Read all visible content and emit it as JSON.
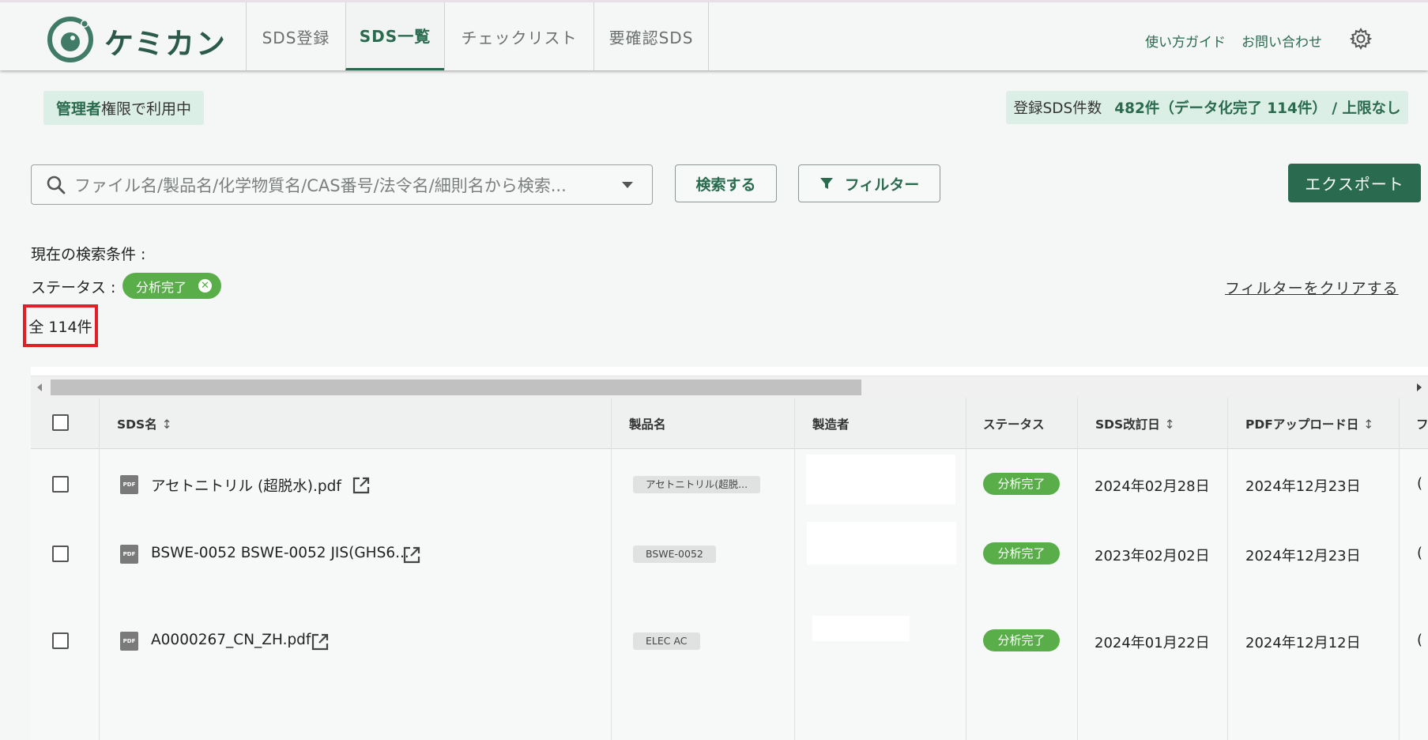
{
  "app": {
    "logo_text": "ケミカン",
    "nav_tabs": [
      "SDS登録",
      "SDS一覧",
      "チェックリスト",
      "要確認SDS"
    ],
    "active_tab": "SDS一覧",
    "header_links": {
      "guide": "使い方ガイド",
      "contact": "お問い合わせ"
    },
    "accent_color": "#2a6b4f",
    "status_color": "#5aae4a"
  },
  "info": {
    "admin_strong": "管理者",
    "admin_rest": "権限で利用中",
    "count_label": "登録SDS件数",
    "count_value": "482件（データ化完了 114件） / 上限なし"
  },
  "search": {
    "placeholder": "ファイル名/製品名/化学物質名/CAS番号/法令名/細則名から検索...",
    "search_button": "検索する",
    "filter_button": "フィルター",
    "export_button": "エクスポート"
  },
  "filters": {
    "current_label": "現在の検索条件 :",
    "status_label": "ステータス :",
    "status_chip": "分析完了",
    "clear_link": "フィルターをクリアする",
    "total": "全 114件"
  },
  "table": {
    "columns": [
      "SDS名",
      "製品名",
      "製造者",
      "ステータス",
      "SDS改訂日",
      "PDFアップロード日"
    ],
    "cut_column_char": "フ",
    "rows": [
      {
        "sds_name": "アセトニトリル (超脱水).pdf",
        "product": "アセトニトリル(超脱...",
        "status": "分析完了",
        "revised": "2024年02月28日",
        "uploaded": "2024年12月23日",
        "cut": "("
      },
      {
        "sds_name": "BSWE-0052 BSWE-0052 JIS(GHS6...",
        "product": "BSWE-0052",
        "status": "分析完了",
        "revised": "2023年02月02日",
        "uploaded": "2024年12月23日",
        "cut": "("
      },
      {
        "sds_name": "A0000267_CN_ZH.pdf",
        "product": "ELEC AC",
        "status": "分析完了",
        "revised": "2024年01月22日",
        "uploaded": "2024年12月12日",
        "cut": "("
      }
    ]
  }
}
